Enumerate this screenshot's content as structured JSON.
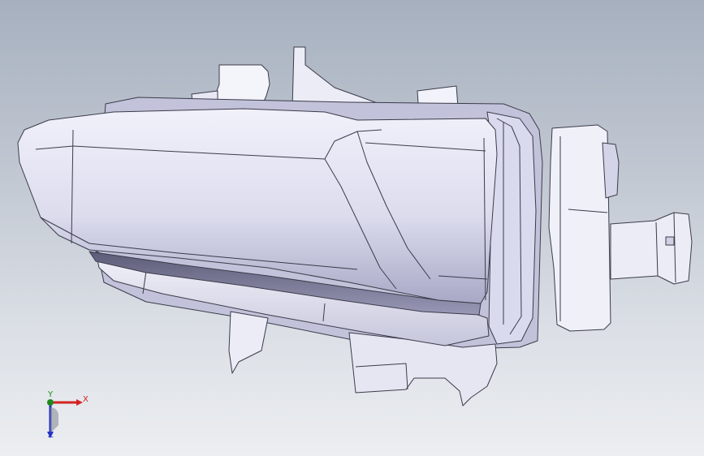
{
  "graphics_area": {
    "background_top": "#a6b0bf",
    "background_bottom": "#eceef1",
    "model_fill": "#e4e4f3",
    "model_shade": "#9c9cba",
    "edge_color": "#3b3b4a"
  },
  "triad": {
    "x_label": "X",
    "y_label": "Y",
    "z_label": "Z",
    "x_color": "#d42222",
    "y_color": "#1e8a1e",
    "z_color": "#2230c4"
  }
}
